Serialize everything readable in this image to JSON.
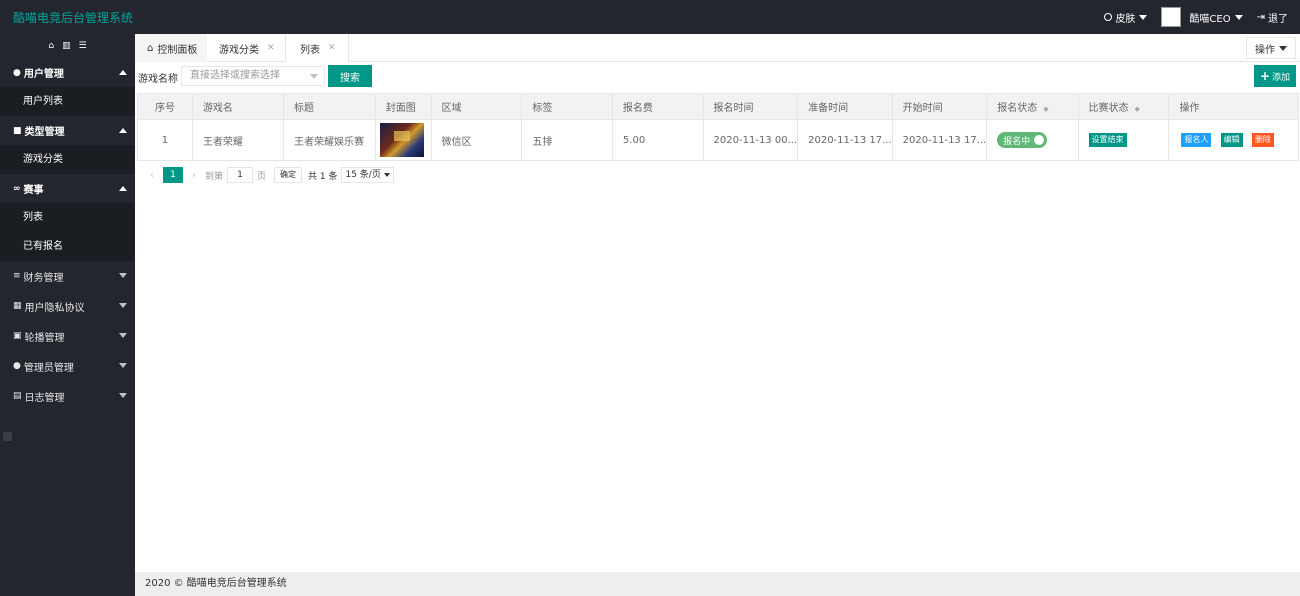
{
  "app": {
    "title": "酷喵电竞后台管理系统"
  },
  "header": {
    "skin_label": "皮肤",
    "user_name": "酷喵CEO",
    "logout_label": "退了"
  },
  "sidebar": {
    "groups": [
      {
        "label": "用户管理",
        "icon": "user-icon",
        "expanded": true,
        "items": [
          "用户列表"
        ]
      },
      {
        "label": "类型管理",
        "icon": "folder-icon",
        "expanded": true,
        "items": [
          "游戏分类"
        ]
      },
      {
        "label": "赛事",
        "icon": "gamepad-icon",
        "expanded": true,
        "items": [
          "列表",
          "已有报名"
        ]
      },
      {
        "label": "财务管理",
        "icon": "list-icon",
        "expanded": false,
        "items": []
      },
      {
        "label": "用户隐私协议",
        "icon": "doc-icon",
        "expanded": false,
        "items": []
      },
      {
        "label": "轮播管理",
        "icon": "image-icon",
        "expanded": false,
        "items": []
      },
      {
        "label": "管理员管理",
        "icon": "user-icon",
        "expanded": false,
        "items": []
      },
      {
        "label": "日志管理",
        "icon": "book-icon",
        "expanded": false,
        "items": []
      }
    ]
  },
  "tabs": [
    {
      "label": "控制面板",
      "closable": false
    },
    {
      "label": "游戏分类",
      "closable": true
    },
    {
      "label": "列表",
      "closable": true,
      "active": true
    }
  ],
  "tabs_ops_label": "操作",
  "toolbar": {
    "game_name_label": "游戏名称",
    "select_placeholder": "直接选择或搜索选择",
    "search_label": "搜索",
    "add_label": "添加"
  },
  "table": {
    "columns": [
      "序号",
      "游戏名",
      "标题",
      "封面图",
      "区域",
      "标签",
      "报名费",
      "报名时间",
      "准备时间",
      "开始时间",
      "报名状态",
      "比赛状态",
      "操作"
    ],
    "rows": [
      {
        "id": "1",
        "game": "王者荣耀",
        "title": "王者荣耀娱乐赛",
        "region": "微信区",
        "tag": "五排",
        "fee": "5.00",
        "signup_time": "2020-11-13 00...",
        "prepare_time": "2020-11-13 17...",
        "start_time": "2020-11-13 17...",
        "signup_status": "报名中",
        "match_action": "设置结束",
        "actions": {
          "signups": "报名人",
          "edit": "编辑",
          "delete": "删除"
        }
      }
    ]
  },
  "pager": {
    "current": "1",
    "goto_label": "到第",
    "page_value": "1",
    "page_unit": "页",
    "confirm_label": "确定",
    "total_label": "共 1 条",
    "size_label": "15 条/页"
  },
  "footer": {
    "text": "2020 © 酷喵电竞后台管理系统"
  }
}
